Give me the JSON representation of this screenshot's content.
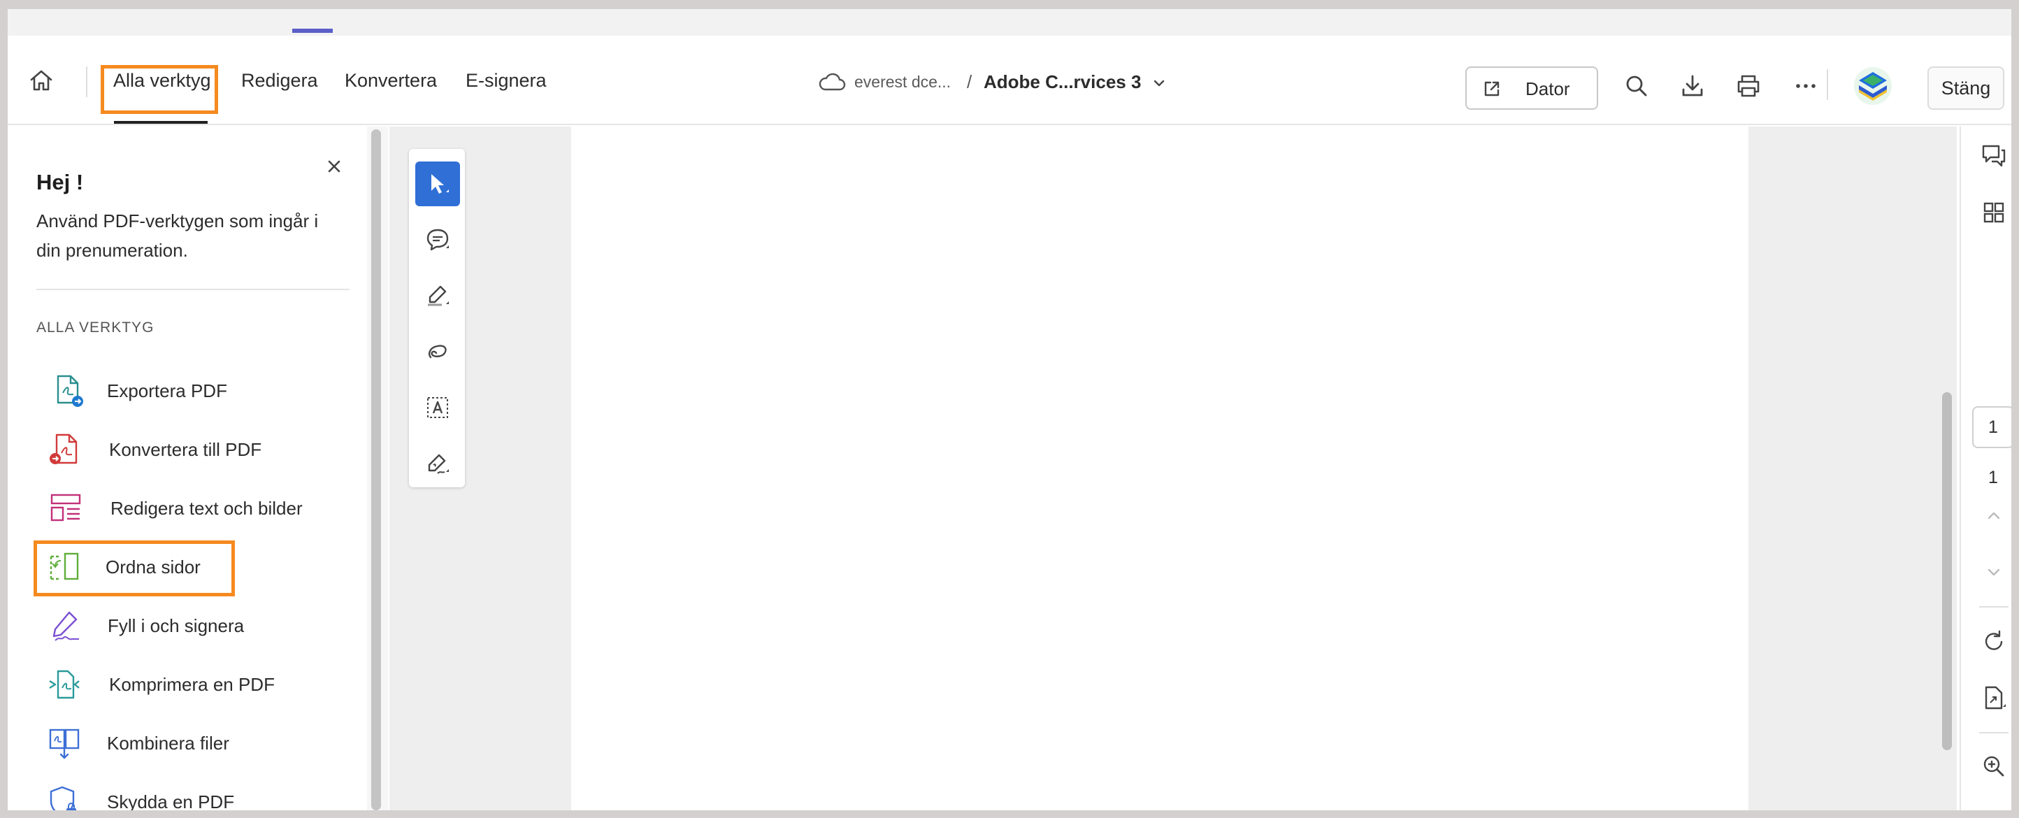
{
  "nav": {
    "home_icon": "home-icon",
    "tabs": [
      {
        "label": "Alla verktyg",
        "active": true
      },
      {
        "label": "Redigera"
      },
      {
        "label": "Konvertera"
      },
      {
        "label": "E-signera"
      }
    ]
  },
  "breadcrumb": {
    "cloud_icon": "cloud-icon",
    "folder": "everest dce...",
    "separator": "/",
    "title": "Adobe C...rvices 3"
  },
  "toolbar": {
    "dator_label": "Dator",
    "close_label": "Stäng"
  },
  "left_panel": {
    "greeting": "Hej !",
    "subtext": "Använd PDF-verktygen som ingår i din prenumeration.",
    "section_title": "ALLA VERKTYG",
    "tools": [
      {
        "label": "Exportera PDF",
        "icon": "export-pdf-icon"
      },
      {
        "label": "Konvertera till PDF",
        "icon": "convert-pdf-icon"
      },
      {
        "label": "Redigera text och bilder",
        "icon": "edit-text-images-icon"
      },
      {
        "label": "Ordna sidor",
        "icon": "organize-pages-icon",
        "highlighted": true
      },
      {
        "label": "Fyll i och signera",
        "icon": "fill-sign-icon"
      },
      {
        "label": "Komprimera en PDF",
        "icon": "compress-pdf-icon"
      },
      {
        "label": "Kombinera filer",
        "icon": "combine-files-icon"
      },
      {
        "label": "Skydda en PDF",
        "icon": "protect-pdf-icon"
      }
    ]
  },
  "quick_tools": [
    "select-icon",
    "comment-icon",
    "highlight-icon",
    "draw-icon",
    "text-select-icon",
    "sign-icon"
  ],
  "right_rail": {
    "current_page": "1",
    "total_pages": "1"
  },
  "colors": {
    "accent_blue": "#2f6fd6",
    "highlight_orange": "#f58a1f",
    "strip_accent": "#5b5fc7"
  }
}
